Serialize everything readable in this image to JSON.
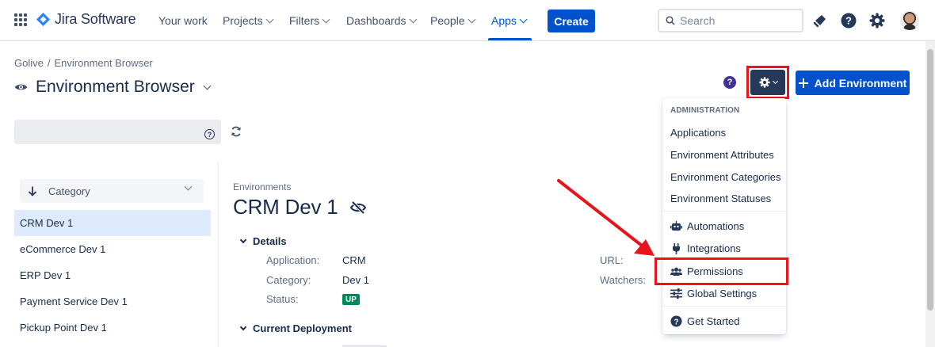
{
  "topnav": {
    "app_name": "Jira Software",
    "items": [
      {
        "label": "Your work"
      },
      {
        "label": "Projects"
      },
      {
        "label": "Filters"
      },
      {
        "label": "Dashboards"
      },
      {
        "label": "People"
      },
      {
        "label": "Apps"
      }
    ],
    "create_label": "Create",
    "search_placeholder": "Search",
    "brand_color": "#0052CC"
  },
  "header": {
    "breadcrumb": [
      "Golive",
      "/",
      "Environment Browser"
    ],
    "title": "Environment Browser",
    "help_glyph": "?",
    "add_button_label": "Add Environment"
  },
  "filter": {
    "help_glyph": "?"
  },
  "sidebar": {
    "sort_label": "Category",
    "items": [
      {
        "label": "CRM Dev 1",
        "selected": true
      },
      {
        "label": "eCommerce Dev 1"
      },
      {
        "label": "ERP Dev 1"
      },
      {
        "label": "Payment Service Dev 1"
      },
      {
        "label": "Pickup Point Dev 1"
      }
    ]
  },
  "detail": {
    "section_label": "Environments",
    "title": "CRM Dev 1",
    "details_heading": "Details",
    "fields": [
      {
        "label": "Application:",
        "value": "CRM"
      },
      {
        "label": "Category:",
        "value": "Dev 1"
      },
      {
        "label": "Status:",
        "value": "UP"
      }
    ],
    "right_fields": [
      {
        "label": "URL:"
      },
      {
        "label": "Watchers:"
      }
    ],
    "deployment_heading": "Current Deployment",
    "status_color": "#00875A"
  },
  "admin_menu": {
    "heading": "ADMINISTRATION",
    "items": [
      {
        "label": "Applications"
      },
      {
        "label": "Environment Attributes"
      },
      {
        "label": "Environment Categories"
      },
      {
        "label": "Environment Statuses"
      },
      {
        "label": "Automations",
        "icon": "robot-icon"
      },
      {
        "label": "Integrations",
        "icon": "plug-icon"
      },
      {
        "label": "Permissions",
        "icon": "users-icon"
      },
      {
        "label": "Global Settings",
        "icon": "sliders-icon"
      },
      {
        "label": "Get Started",
        "icon": "question-circle-icon"
      }
    ]
  },
  "annotation": {
    "highlight_color": "#E8141B"
  }
}
